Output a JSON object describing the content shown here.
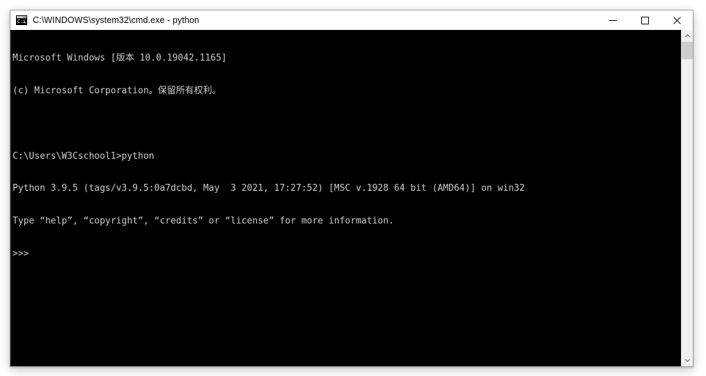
{
  "window": {
    "title": "C:\\WINDOWS\\system32\\cmd.exe - python",
    "icon": "cmd-console-icon",
    "controls": {
      "minimize": "minimize-button",
      "maximize": "maximize-button",
      "close": "close-button"
    }
  },
  "console": {
    "background_color": "#000000",
    "text_color": "#cccccc",
    "lines": [
      "Microsoft Windows [版本 10.0.19042.1165]",
      "(c) Microsoft Corporation。保留所有权利。",
      "",
      "C:\\Users\\W3Cschool1>python",
      "Python 3.9.5 (tags/v3.9.5:0a7dcbd, May  3 2021, 17:27:52) [MSC v.1928 64 bit (AMD64)] on win32",
      "Type “help”, “copyright”, “credits” or “license” for more information.",
      ">>>"
    ],
    "prompt": ">>>",
    "command_entered": "python",
    "working_directory": "C:\\Users\\W3Cschool1"
  },
  "scrollbar": {
    "up_arrow": "chevron-up-icon",
    "down_arrow": "chevron-down-icon",
    "thumb": "scroll-thumb"
  }
}
